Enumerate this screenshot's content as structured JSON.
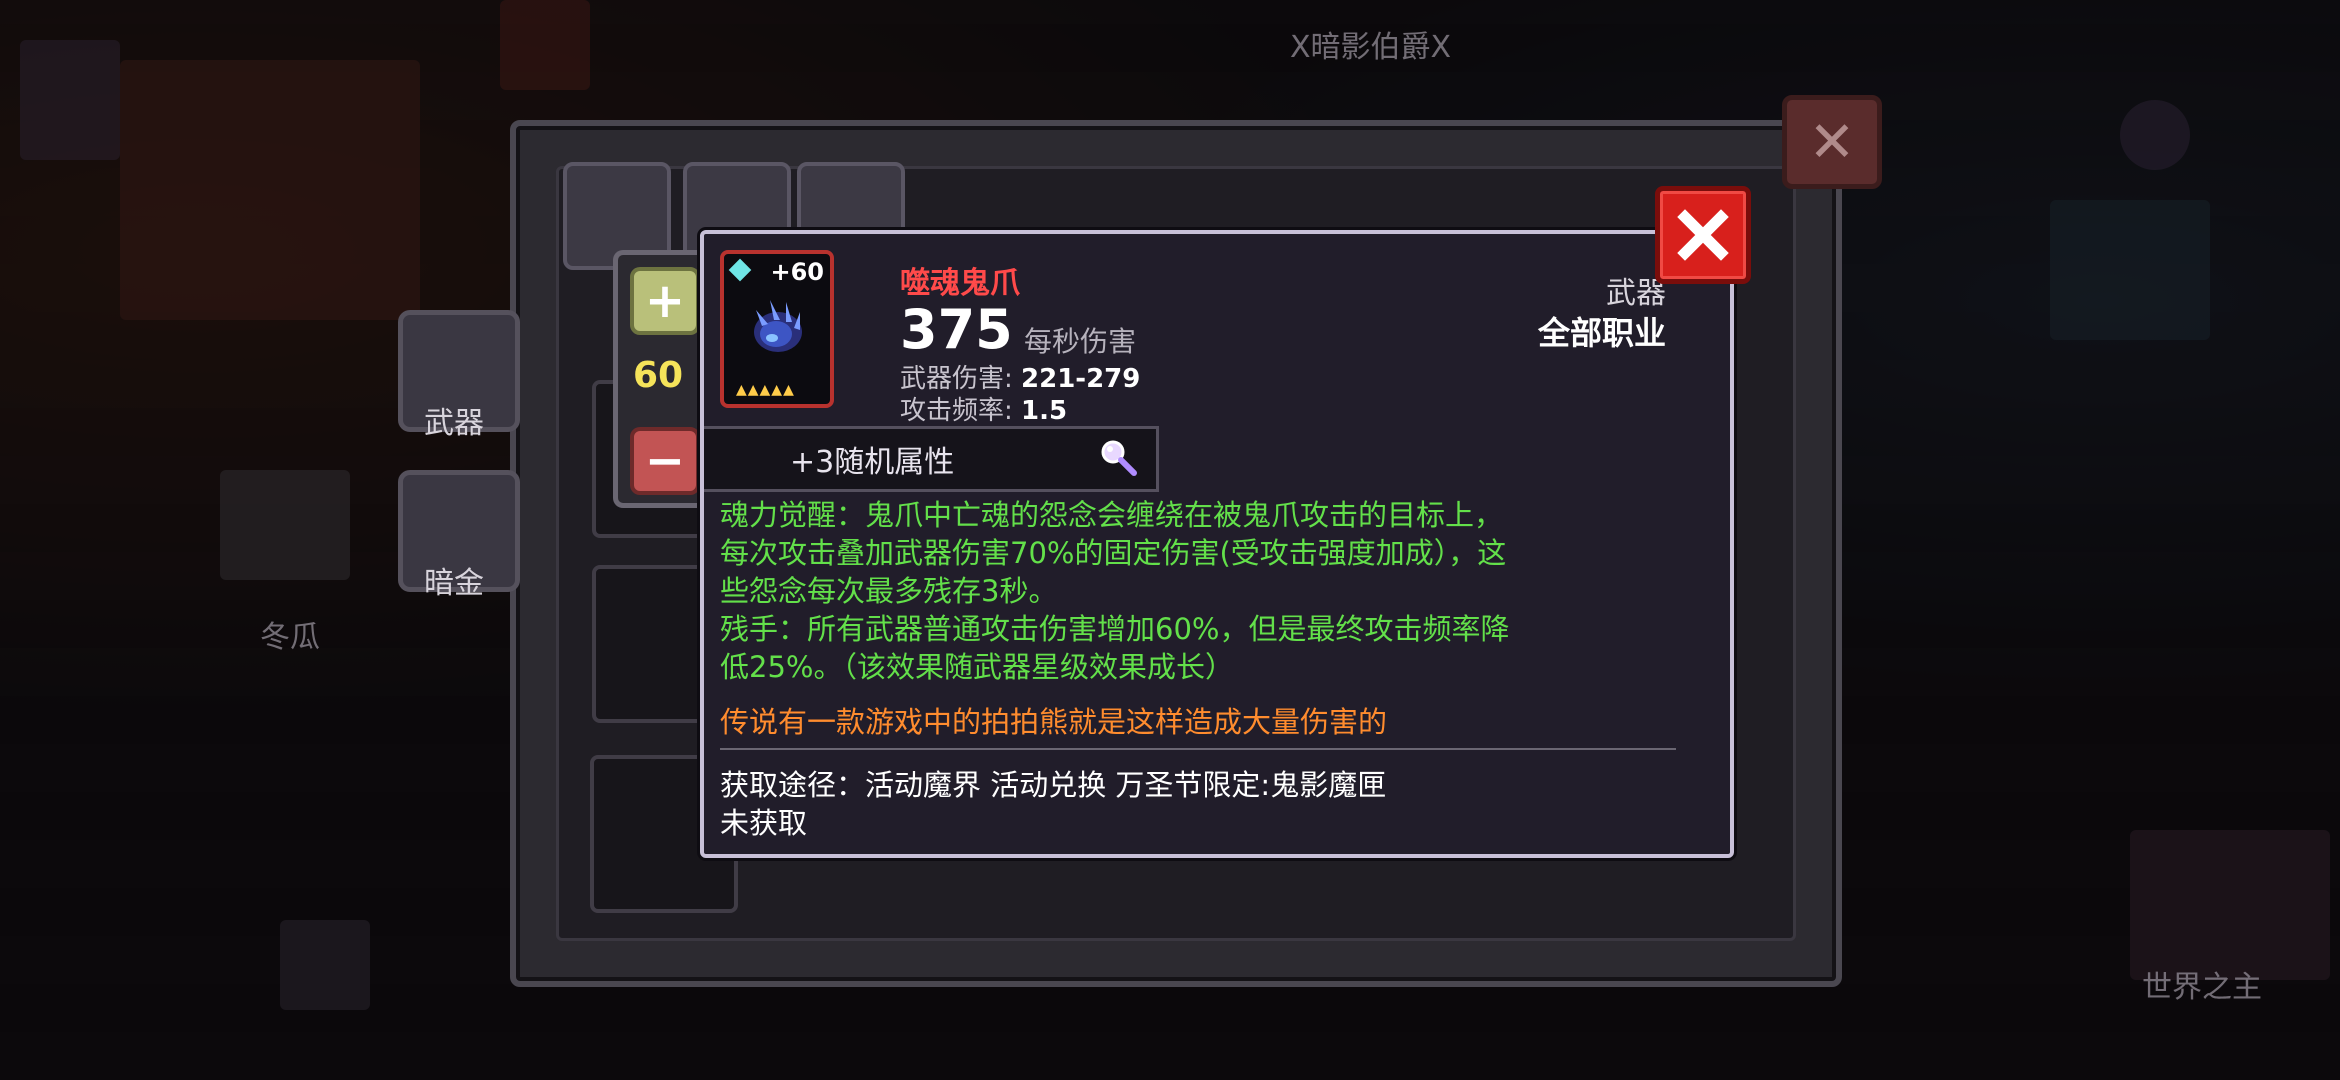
{
  "background": {
    "top_name": "X暗影伯爵X",
    "left_name": "冬瓜",
    "right_name": "世界之主",
    "side_tabs": [
      {
        "label": "武器"
      },
      {
        "label": "暗金"
      }
    ]
  },
  "stepper": {
    "plus_symbol": "+",
    "minus_symbol": "−",
    "value": "60"
  },
  "item": {
    "level_badge": "+60",
    "name": "噬魂鬼爪",
    "type": "武器",
    "class": "全部职业",
    "dps_value": "375",
    "dps_label": "每秒伤害",
    "damage_label": "武器伤害: ",
    "damage_value": "221-279",
    "rate_label": "攻击频率: ",
    "rate_value": "1.5",
    "star_count": 5,
    "random_attr": "+3随机属性",
    "description": "魂力觉醒：鬼爪中亡魂的怨念会缠绕在被鬼爪攻击的目标上，\n每次攻击叠加武器伤害70%的固定伤害(受攻击强度加成），这\n些怨念每次最多残存3秒。\n残手：所有武器普通攻击伤害增加60%，但是最终攻击频率降\n低25%。（该效果随武器星级效果成长）",
    "flavor": "传说有一款游戏中的拍拍熊就是这样造成大量伤害的",
    "source": "获取途径：活动魔界 活动兑换 万圣节限定:鬼影魔匣",
    "status": "未获取"
  },
  "icons": {
    "close": "close-icon",
    "gem": "gem-icon",
    "magnifier": "magnifier-icon"
  },
  "colors": {
    "name_red": "#ff4a4a",
    "desc_green": "#63e04a",
    "flavor_orange": "#ff8c2e",
    "value_yellow": "#f5e35a",
    "close_red": "#d8201c"
  }
}
